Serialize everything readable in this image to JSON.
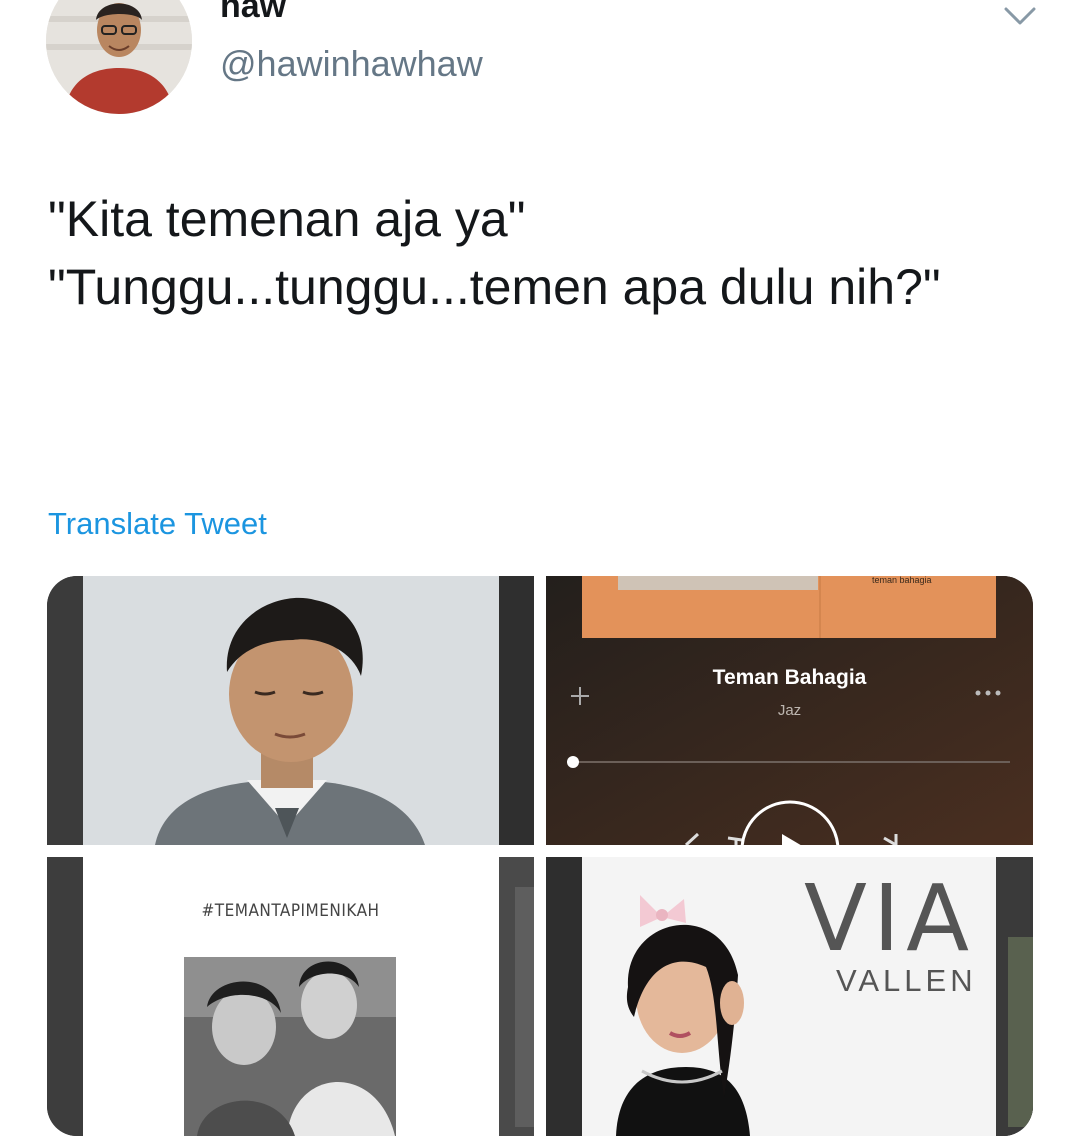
{
  "user": {
    "display_name": "haw",
    "handle": "@hawinhawhaw"
  },
  "tweet": {
    "lines": [
      "\"Kita temenan aja ya\"",
      "\"Tunggu...tunggu...temen apa dulu nih?\""
    ],
    "translate_label": "Translate Tweet"
  },
  "media": {
    "player": {
      "song_title": "Teman Bahagia",
      "artist": "Jaz",
      "album_tag": "teman bahagia"
    },
    "poster": {
      "hashtag": "#TEMANTAPIMENIKAH"
    },
    "album": {
      "title": "VIA",
      "subtitle": "VALLEN"
    }
  },
  "icons": {
    "menu": "chevron-down-icon",
    "add": "plus-icon",
    "more": "more-dots-icon",
    "play": "play-icon"
  },
  "colors": {
    "link": "#1b95e0",
    "handle": "#657786",
    "text": "#14171a"
  }
}
